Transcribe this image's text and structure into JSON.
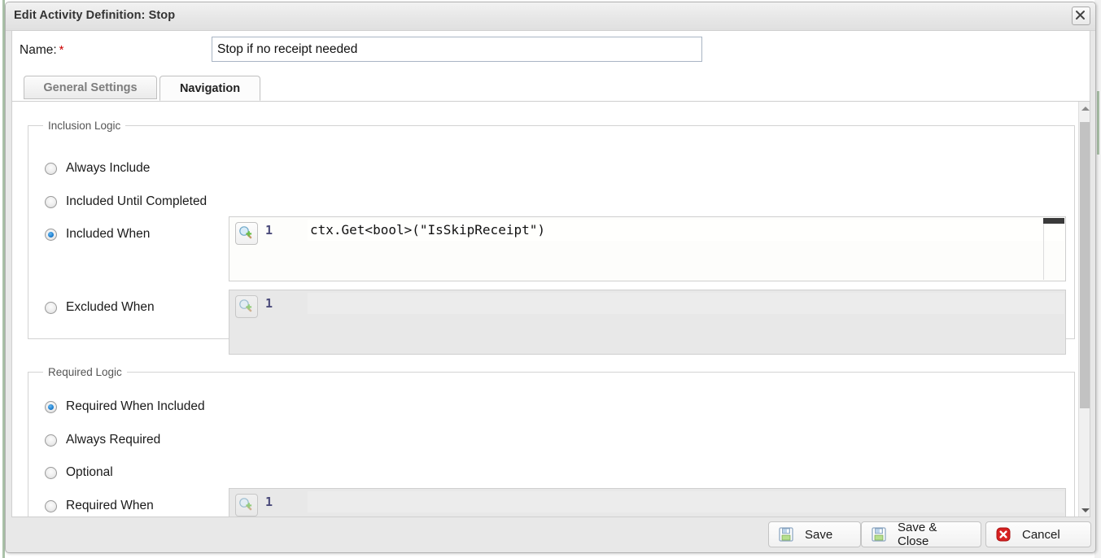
{
  "window": {
    "title": "Edit Activity Definition: Stop",
    "close_icon": "close-icon"
  },
  "name_row": {
    "label": "Name:",
    "required_marker": "*",
    "value": "Stop if no receipt needed",
    "placeholder": ""
  },
  "tabs": [
    {
      "label": "General Settings",
      "active": false
    },
    {
      "label": "Navigation",
      "active": true
    }
  ],
  "inclusion_logic": {
    "legend": "Inclusion Logic",
    "options": [
      {
        "label": "Always Include",
        "checked": false
      },
      {
        "label": "Included Until Completed",
        "checked": false
      },
      {
        "label": "Included When",
        "checked": true
      },
      {
        "label": "Excluded When",
        "checked": false
      }
    ],
    "included_when_editor": {
      "line_number": "1",
      "code": "ctx.Get<bool>(\"IsSkipReceipt\")",
      "enabled": true,
      "button_icon": "magnifier-plus-icon"
    },
    "excluded_when_editor": {
      "line_number": "1",
      "code": "",
      "enabled": false,
      "button_icon": "magnifier-plus-icon"
    }
  },
  "required_logic": {
    "legend": "Required Logic",
    "options": [
      {
        "label": "Required When Included",
        "checked": true
      },
      {
        "label": "Always Required",
        "checked": false
      },
      {
        "label": "Optional",
        "checked": false
      },
      {
        "label": "Required When",
        "checked": false
      }
    ],
    "required_when_editor": {
      "line_number": "1",
      "code": "",
      "enabled": false,
      "button_icon": "magnifier-plus-icon"
    }
  },
  "scrollbar": {
    "up_arrow_icon": "chevron-up-icon",
    "down_arrow_icon": "chevron-down-icon"
  },
  "footer": {
    "save": {
      "label": "Save",
      "icon": "floppy-disk-icon"
    },
    "save_close": {
      "label": "Save & Close",
      "icon": "floppy-disk-icon"
    },
    "cancel": {
      "label": "Cancel",
      "icon": "red-x-icon"
    }
  },
  "colors": {
    "accent_blue": "#1f7fd0",
    "required_red": "#cc0000",
    "cancel_red": "#d72020",
    "title_text": "#333333",
    "dialog_bg": "#e8e8e8"
  }
}
